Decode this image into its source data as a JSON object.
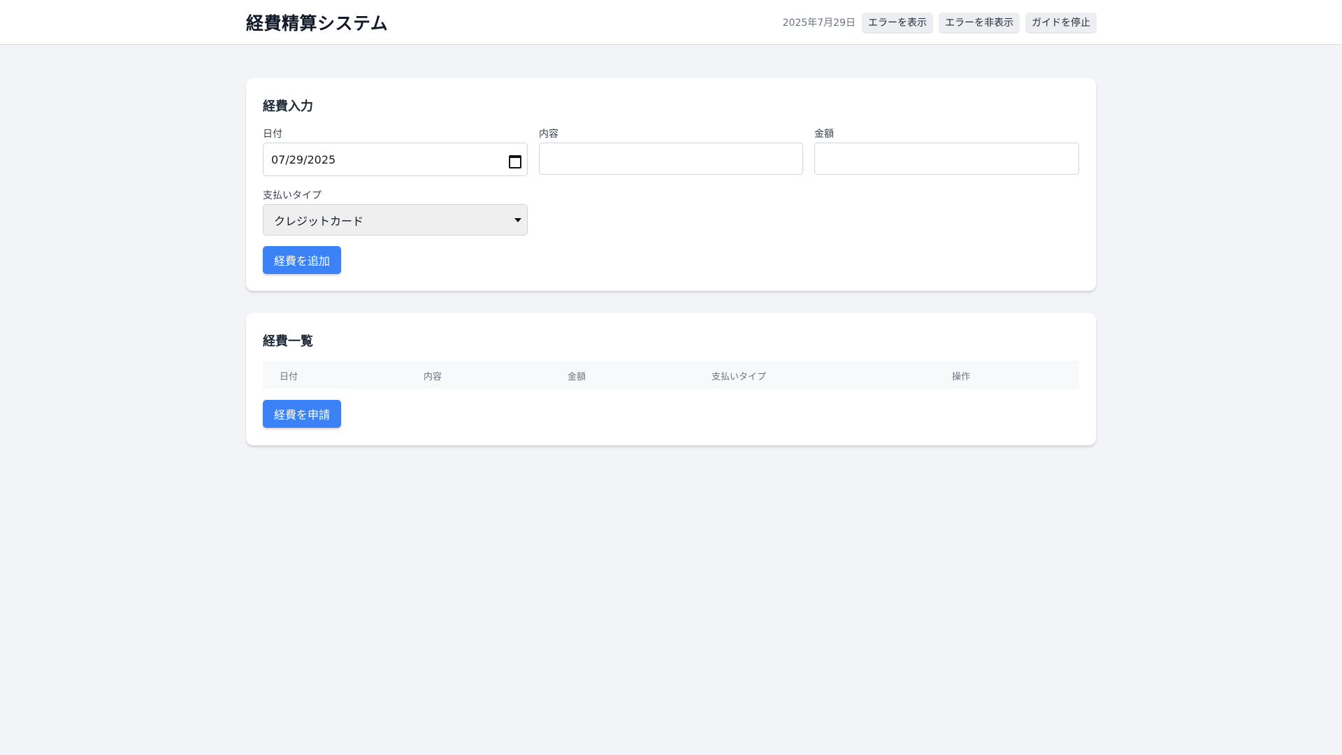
{
  "header": {
    "title": "経費精算システム",
    "date": "2025年7月29日",
    "buttons": {
      "show_error": "エラーを表示",
      "hide_error": "エラーを非表示",
      "stop_guide": "ガイドを停止"
    }
  },
  "input_card": {
    "title": "経費入力",
    "date_label": "日付",
    "date_value": "07/29/2025",
    "description_label": "内容",
    "description_value": "",
    "amount_label": "金額",
    "amount_value": "",
    "payment_label": "支払いタイプ",
    "payment_selected": "クレジットカード",
    "add_button": "経費を追加"
  },
  "list_card": {
    "title": "経費一覧",
    "columns": [
      "日付",
      "内容",
      "金額",
      "支払いタイプ",
      "操作"
    ],
    "submit_button": "経費を申請"
  },
  "icons": {
    "calendar": "calendar-icon",
    "dropdown": "chevron-down-icon"
  },
  "colors": {
    "primary": "#3b82f6",
    "background": "#f3f4f8",
    "card": "#ffffff"
  }
}
